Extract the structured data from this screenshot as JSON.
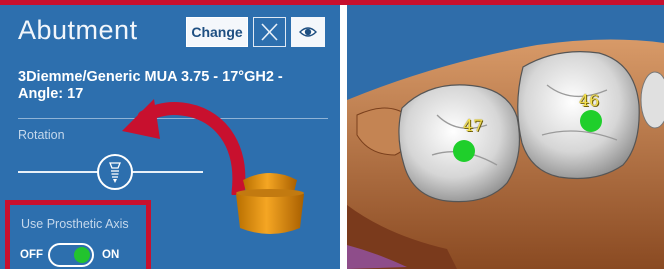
{
  "panel": {
    "title": "Abutment",
    "change_label": "Change",
    "close_icon": "close-icon",
    "eye_icon": "eye-icon",
    "model_name": "3Diemme/Generic MUA 3.75 - 17°GH2 - Angle: 17",
    "rotation_label": "Rotation",
    "rotation_icon": "implant-icon",
    "prosthetic_axis_label": "Use Prosthetic Axis",
    "toggle_off": "OFF",
    "toggle_on": "ON",
    "toggle_state": true
  },
  "viewport": {
    "tooth_labels": [
      "47",
      "46"
    ]
  },
  "colors": {
    "panel_bg": "#2d6fae",
    "highlight_red": "#c8102e",
    "toggle_green": "#22c32e",
    "label_yellow": "#f4e04d"
  }
}
